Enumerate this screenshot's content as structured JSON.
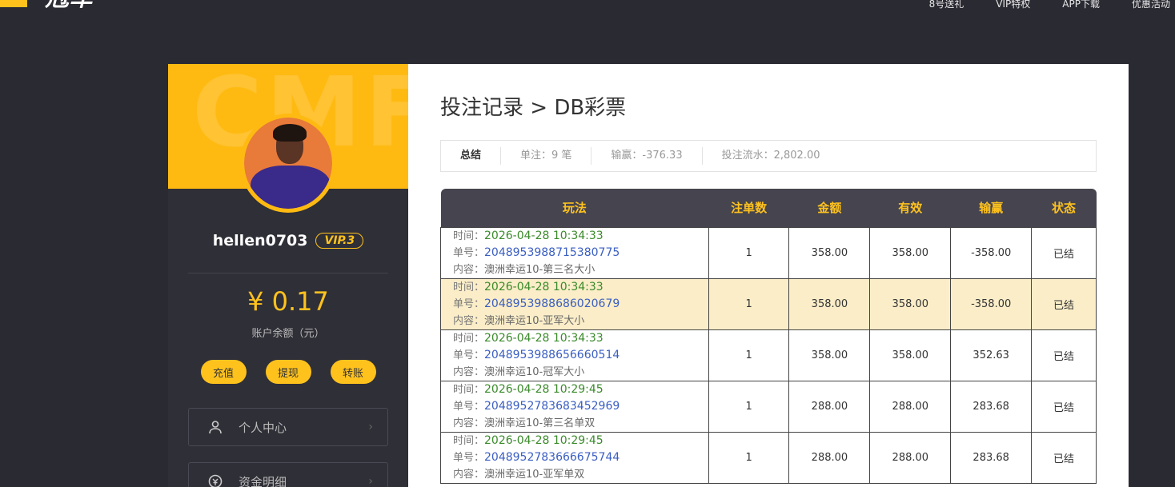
{
  "logo": {
    "text": "冠军"
  },
  "topnav": [
    "8号送礼",
    "VIP特权",
    "APP下载",
    "优惠活动"
  ],
  "sidebar": {
    "watermark": "CMF",
    "username": "hellen0703",
    "vip": "VIP.3",
    "balance": "¥ 0.17",
    "balance_label": "账户余额（元）",
    "actions": [
      "充值",
      "提现",
      "转账"
    ],
    "menu": [
      {
        "label": "个人中心",
        "icon": "user-icon"
      },
      {
        "label": "资金明细",
        "icon": "money-icon"
      }
    ]
  },
  "main": {
    "title": "投注记录 > DB彩票",
    "summary": {
      "label": "总结",
      "count": "单注：9 笔",
      "profit": "输赢：-376.33",
      "turnover": "投注流水：2,802.00"
    },
    "table": {
      "headers": [
        "玩法",
        "注单数",
        "金额",
        "有效",
        "输赢",
        "状态"
      ],
      "labels": {
        "time": "时间：",
        "no": "单号：",
        "content": "内容："
      },
      "rows": [
        {
          "time": "2026-04-28 10:34:33",
          "no": "2048953988715380775",
          "content": "澳洲幸运10-第三名大小",
          "count": "1",
          "amount": "358.00",
          "valid": "358.00",
          "profit": "-358.00",
          "status": "已结"
        },
        {
          "time": "2026-04-28 10:34:33",
          "no": "2048953988686020679",
          "content": "澳洲幸运10-亚军大小",
          "count": "1",
          "amount": "358.00",
          "valid": "358.00",
          "profit": "-358.00",
          "status": "已结"
        },
        {
          "time": "2026-04-28 10:34:33",
          "no": "2048953988656660514",
          "content": "澳洲幸运10-冠军大小",
          "count": "1",
          "amount": "358.00",
          "valid": "358.00",
          "profit": "352.63",
          "status": "已结"
        },
        {
          "time": "2026-04-28 10:29:45",
          "no": "2048952783683452969",
          "content": "澳洲幸运10-第三名单双",
          "count": "1",
          "amount": "288.00",
          "valid": "288.00",
          "profit": "283.68",
          "status": "已结"
        },
        {
          "time": "2026-04-28 10:29:45",
          "no": "2048952783666675744",
          "content": "澳洲幸运10-亚军单双",
          "count": "1",
          "amount": "288.00",
          "valid": "288.00",
          "profit": "283.68",
          "status": "已结"
        }
      ]
    }
  }
}
